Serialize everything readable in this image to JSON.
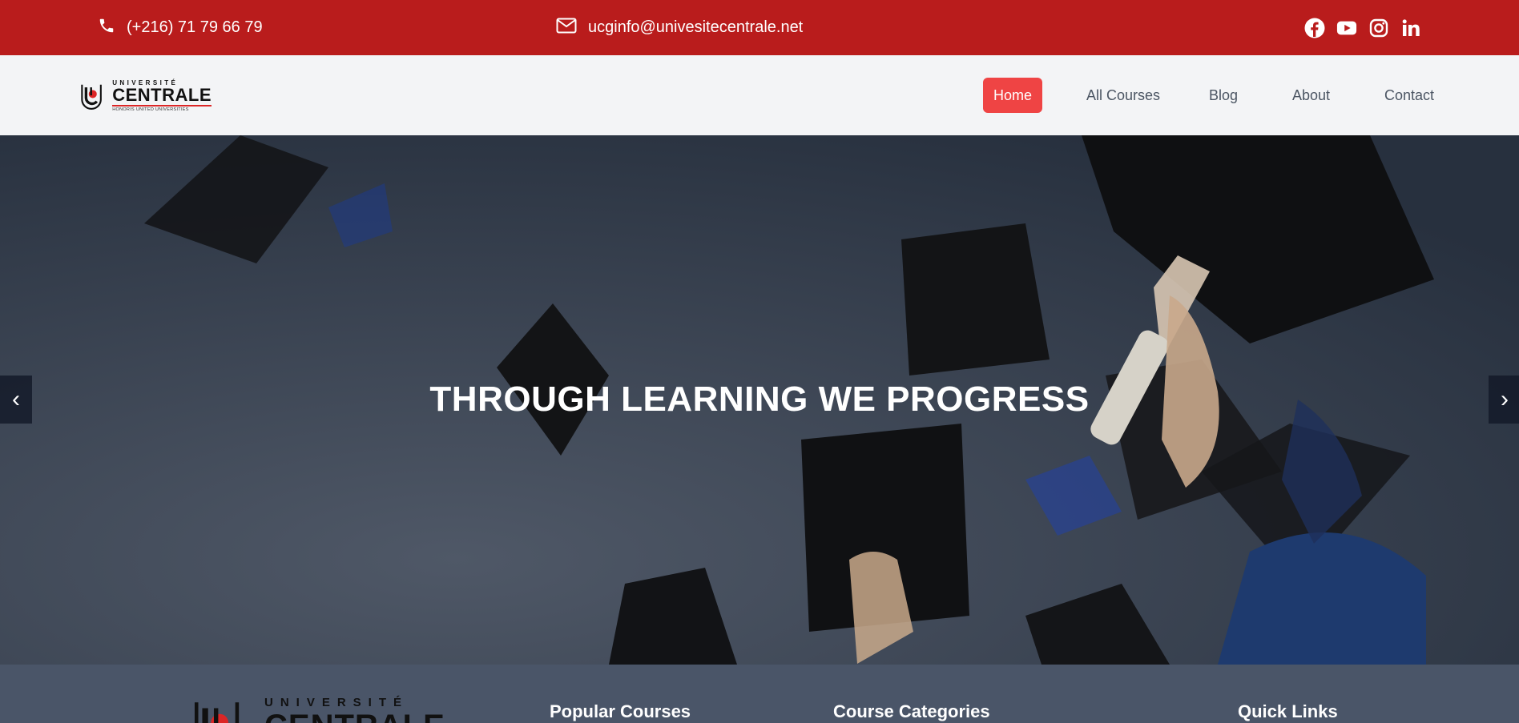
{
  "topbar": {
    "phone": "(+216) 71 79 66 79",
    "email": "ucginfo@univesitecentrale.net",
    "social_icons": [
      "facebook-icon",
      "youtube-icon",
      "instagram-icon",
      "linkedin-icon"
    ]
  },
  "logo": {
    "top_text": "UNIVERSITÉ",
    "main_text": "CENTRALE",
    "sub_text": "HONORIS UNITED UNIVERSITIES"
  },
  "nav": {
    "items": [
      {
        "label": "Home",
        "active": true
      },
      {
        "label": "All Courses"
      },
      {
        "label": "Blog"
      },
      {
        "label": "About"
      },
      {
        "label": "Contact"
      }
    ]
  },
  "hero": {
    "title": "THROUGH LEARNING WE PROGRESS",
    "prev_icon": "‹",
    "next_icon": "›"
  },
  "footer": {
    "logo_top": "UNIVERSITÉ",
    "logo_main": "CENTRALE",
    "headings": [
      "Popular Courses",
      "Course Categories",
      "Quick Links"
    ]
  },
  "colors": {
    "topbar": "#b91c1c",
    "accent": "#ef4444",
    "nav_bg": "#f3f4f6",
    "footer_bg": "#4a5568"
  }
}
